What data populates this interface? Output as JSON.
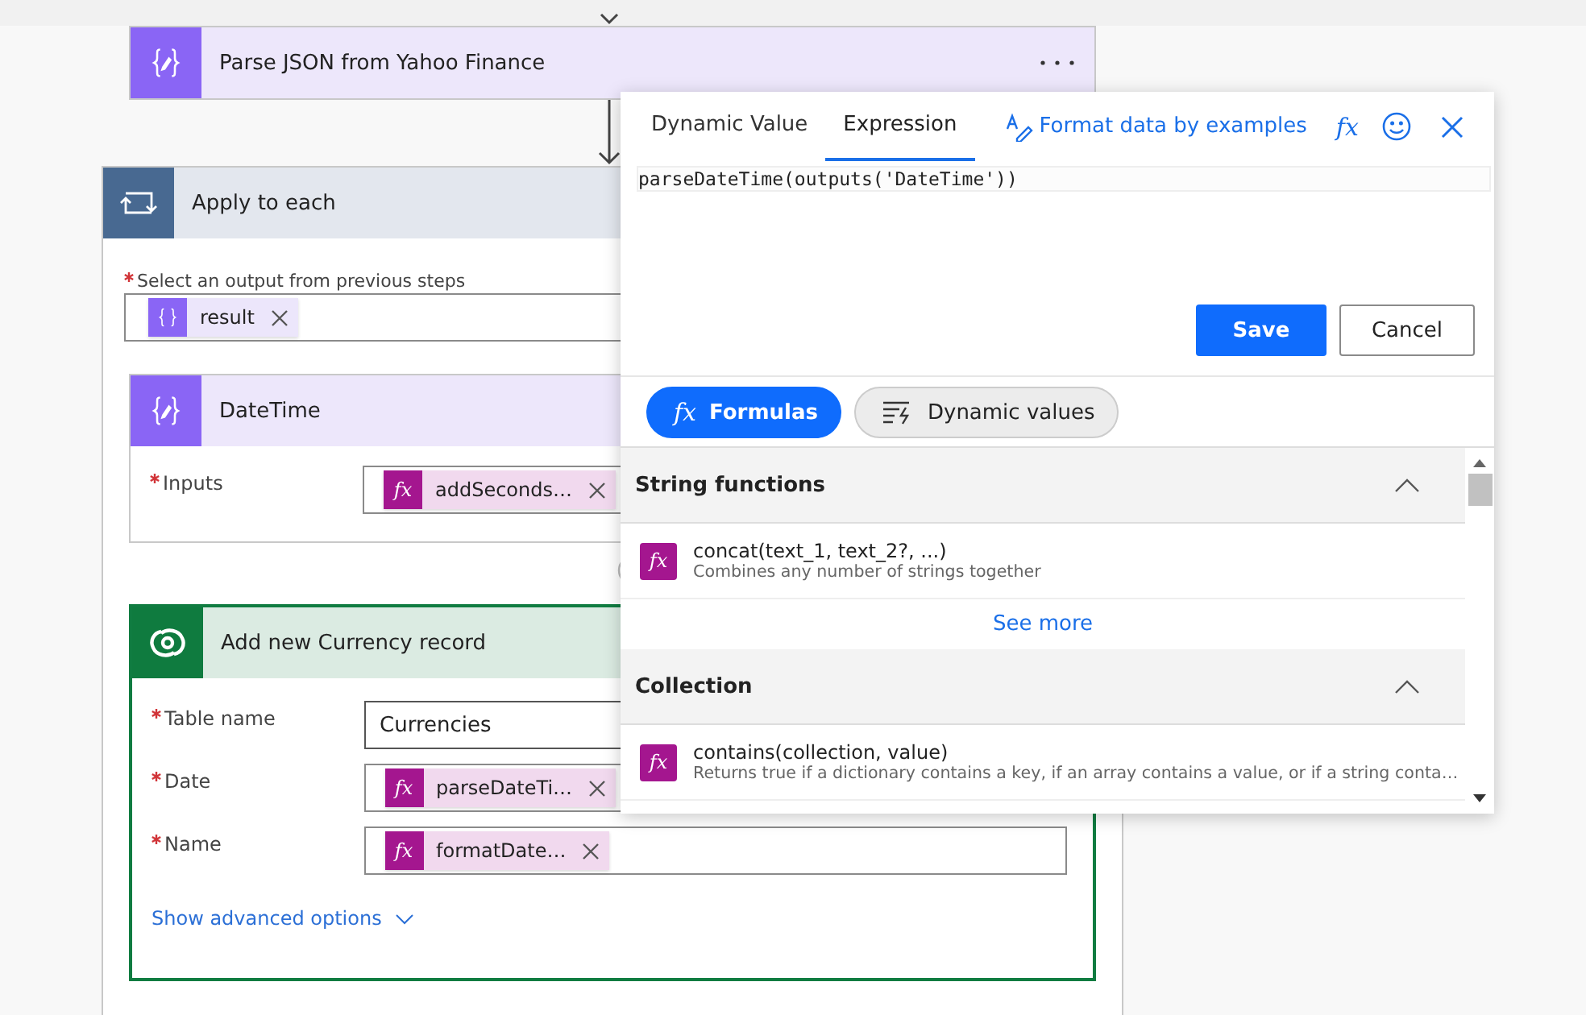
{
  "flow": {
    "parse_step": {
      "title": "Parse JSON from Yahoo Finance"
    },
    "apply_to_each": {
      "title": "Apply to each",
      "output_label": "Select an output from previous steps",
      "required": true,
      "tokens": [
        {
          "label": "result",
          "kind": "json"
        }
      ]
    },
    "datetime_step": {
      "title": "DateTime",
      "fields": [
        {
          "label": "Inputs",
          "required": true,
          "tokens": [
            {
              "label": "addSeconds…",
              "kind": "expression",
              "icon": "fx"
            }
          ]
        }
      ]
    },
    "record_step": {
      "title": "Add new Currency record",
      "selected": true,
      "fields": [
        {
          "label": "Table name",
          "required": true,
          "value": "Currencies"
        },
        {
          "label": "Date",
          "required": true,
          "tokens": [
            {
              "label": "parseDateTi…",
              "kind": "expression",
              "icon": "fx"
            }
          ]
        },
        {
          "label": "Name",
          "required": true,
          "tokens": [
            {
              "label": "formatDate…",
              "kind": "expression",
              "icon": "fx"
            }
          ]
        }
      ],
      "advanced_link": "Show advanced options"
    }
  },
  "expression_popover": {
    "tabs": [
      {
        "label": "Dynamic Value",
        "selected": false
      },
      {
        "label": "Expression",
        "selected": true
      }
    ],
    "format_link": "Format data by examples",
    "fx_button": "fx",
    "expression": "parseDateTime(outputs('DateTime'))",
    "save_button": "Save",
    "cancel_button": "Cancel",
    "pills": [
      {
        "label": "Formulas",
        "kind": "formulas",
        "icon": "fx",
        "selected": true
      },
      {
        "label": "Dynamic values",
        "kind": "dynamic",
        "selected": false
      }
    ],
    "sections": [
      {
        "title": "String functions",
        "expanded": true,
        "items": [
          {
            "icon": "fx",
            "name": "concat(text_1, text_2?, ...)",
            "description": "Combines any number of strings together"
          }
        ],
        "see_more": "See more"
      },
      {
        "title": "Collection",
        "expanded": true,
        "items": [
          {
            "icon": "fx",
            "name": "contains(collection, value)",
            "description": "Returns true if a dictionary contains a key, if an array contains a value, or if a string conta…"
          }
        ]
      }
    ]
  }
}
